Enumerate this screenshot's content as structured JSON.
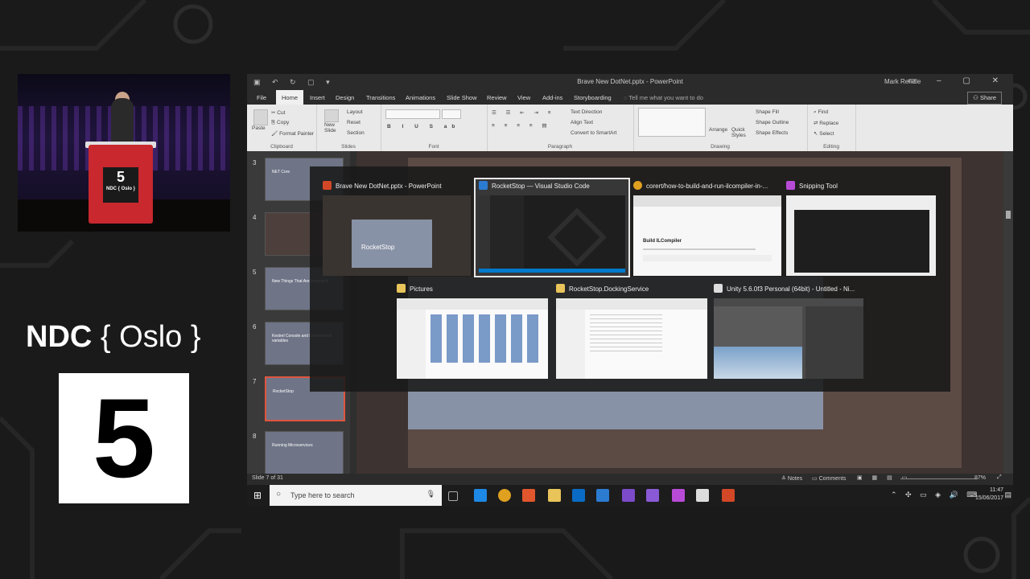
{
  "event": {
    "logo_bold": "NDC",
    "logo_rest": "{ Oslo }",
    "room_number": "5",
    "podium_number": "5",
    "podium_text": "NDC { Oslo }"
  },
  "powerpoint": {
    "window_title": "Brave New DotNet.pptx - PowerPoint",
    "user_name": "Mark Rendle",
    "tabs": [
      "File",
      "Home",
      "Insert",
      "Design",
      "Transitions",
      "Animations",
      "Slide Show",
      "Review",
      "View",
      "Add-ins",
      "Storyboarding"
    ],
    "active_tab": "Home",
    "tell_me": "Tell me what you want to do",
    "share_label": "Share",
    "ribbon": {
      "clipboard": {
        "label": "Clipboard",
        "paste": "Paste",
        "cut": "Cut",
        "copy": "Copy",
        "format_painter": "Format Painter"
      },
      "slides": {
        "label": "Slides",
        "new_slide": "New Slide",
        "layout": "Layout",
        "reset": "Reset",
        "section": "Section"
      },
      "font": {
        "label": "Font"
      },
      "paragraph": {
        "label": "Paragraph",
        "text_direction": "Text Direction",
        "align_text": "Align Text",
        "convert_smartart": "Convert to SmartArt"
      },
      "drawing": {
        "label": "Drawing",
        "arrange": "Arrange",
        "quick_styles": "Quick Styles",
        "shape_fill": "Shape Fill",
        "shape_outline": "Shape Outline",
        "shape_effects": "Shape Effects"
      },
      "editing": {
        "label": "Editing",
        "find": "Find",
        "replace": "Replace",
        "select": "Select"
      }
    },
    "slides": [
      {
        "num": "3",
        "text": "NET Core"
      },
      {
        "num": "4",
        "text": ""
      },
      {
        "num": "5",
        "text": "New Things That Are Important!"
      },
      {
        "num": "6",
        "text": "Kestrel Console and Environment variables"
      },
      {
        "num": "7",
        "text": "RocketStop"
      },
      {
        "num": "8",
        "text": "Running Microservices"
      }
    ],
    "status": {
      "slide_info": "Slide 7 of 31",
      "notes": "Notes",
      "comments": "Comments",
      "zoom": "87%"
    }
  },
  "taskbar": {
    "search_placeholder": "Type here to search",
    "time": "11:47",
    "date": "15/06/2017"
  },
  "switcher": {
    "windows": [
      {
        "title": "Brave New DotNet.pptx - PowerPoint",
        "icon": "powerpoint-icon",
        "color": "#d24726"
      },
      {
        "title": "RocketStop — Visual Studio Code",
        "icon": "vscode-icon",
        "color": "#2b7bd0"
      },
      {
        "title": "corert/how-to-build-and-run-ilcompiler-in-...",
        "icon": "chrome-icon",
        "color": "#e0a020"
      },
      {
        "title": "Snipping Tool",
        "icon": "snipping-tool-icon",
        "color": "#b84bd6"
      },
      {
        "title": "Pictures",
        "icon": "folder-icon",
        "color": "#e8c45a"
      },
      {
        "title": "RocketStop.DockingService",
        "icon": "folder-icon",
        "color": "#e8c45a"
      },
      {
        "title": "Unity 5.6.0f3 Personal (64bit) - Untitled - Ni...",
        "icon": "unity-icon",
        "color": "#dddddd"
      }
    ],
    "chrome_heading": "Build ILCompiler",
    "pptx_slide_title": "RocketStop"
  },
  "colors": {
    "accent_red": "#c8282e",
    "slide_blue": "#8892a6",
    "selected_border": "#e0553f"
  }
}
